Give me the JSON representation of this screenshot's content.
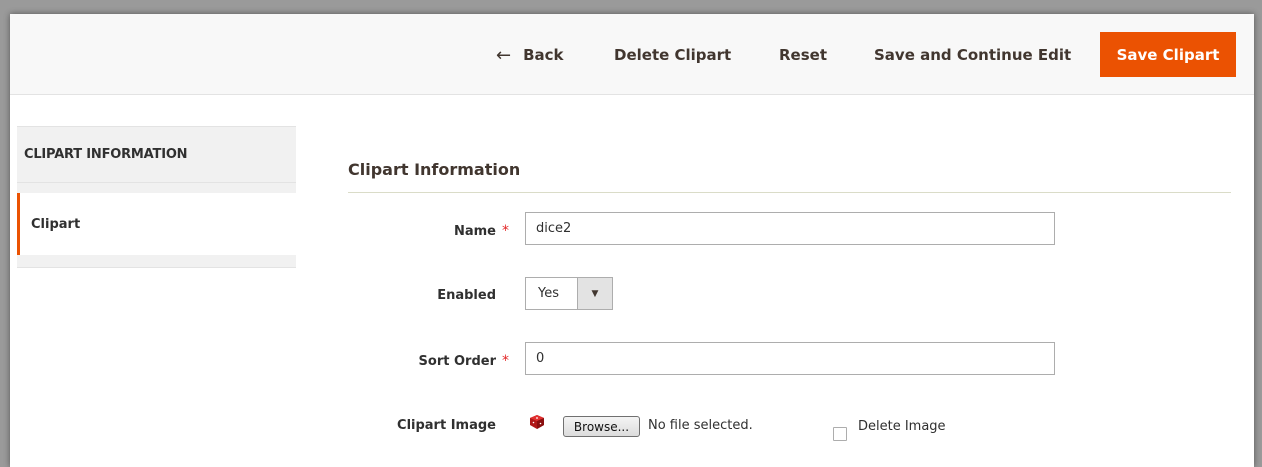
{
  "actions": {
    "back_label": "Back",
    "delete_label": "Delete Clipart",
    "reset_label": "Reset",
    "save_continue_label": "Save and Continue Edit",
    "save_label": "Save Clipart"
  },
  "sidebar": {
    "title": "CLIPART INFORMATION",
    "items": [
      {
        "label": "Clipart"
      }
    ]
  },
  "form": {
    "section_title": "Clipart Information",
    "fields": {
      "name": {
        "label": "Name",
        "value": "dice2",
        "required": true
      },
      "enabled": {
        "label": "Enabled",
        "value": "Yes"
      },
      "sort_order": {
        "label": "Sort Order",
        "value": "0",
        "required": true
      },
      "image": {
        "label": "Clipart Image",
        "browse_label": "Browse...",
        "file_status": "No file selected.",
        "delete_label": "Delete Image"
      }
    },
    "required_marker": "*"
  },
  "colors": {
    "accent": "#eb5202",
    "required": "#e22626",
    "text": "#303030"
  },
  "icons": {
    "back": "arrow-left-icon",
    "select": "caret-down-icon",
    "thumbnail": "dice-icon"
  }
}
